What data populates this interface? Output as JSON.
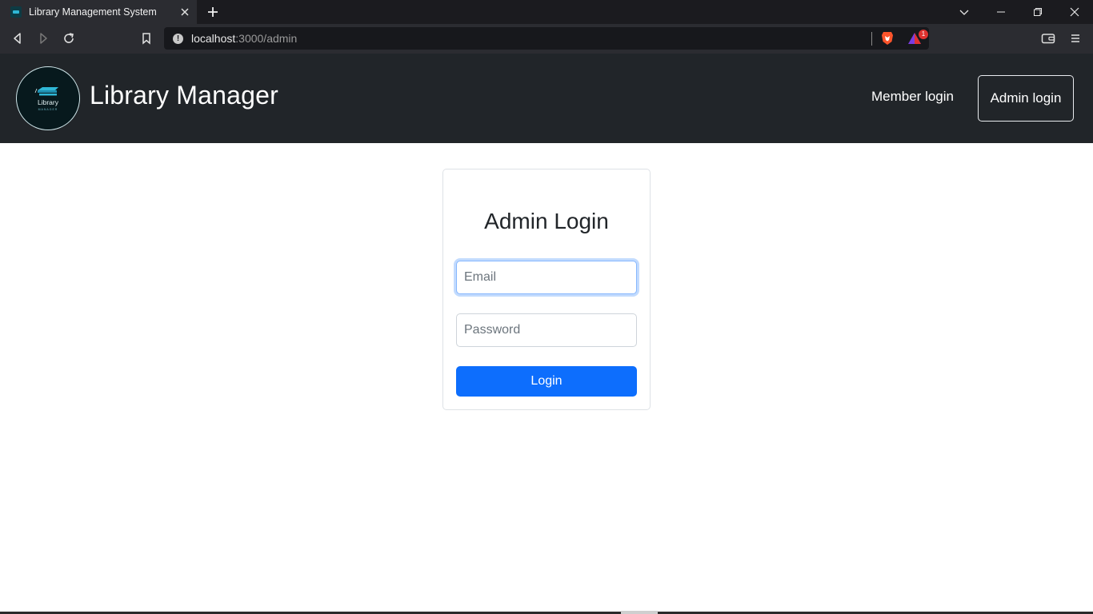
{
  "browser": {
    "tab_title": "Library Management System",
    "new_tab_label": "+",
    "url_host": "localhost",
    "url_rest": ":3000/admin",
    "shields_badge_count": "1"
  },
  "navbar": {
    "logo_text": "Library",
    "logo_subtext": "MANAGER",
    "brand": "Library Manager",
    "member_login": "Member login",
    "admin_login": "Admin login"
  },
  "login_form": {
    "title": "Admin Login",
    "email_placeholder": "Email",
    "password_placeholder": "Password",
    "submit_label": "Login"
  },
  "colors": {
    "navbar_bg": "#212529",
    "primary_button": "#0d6efd",
    "focus_ring": "#86b7fe"
  }
}
